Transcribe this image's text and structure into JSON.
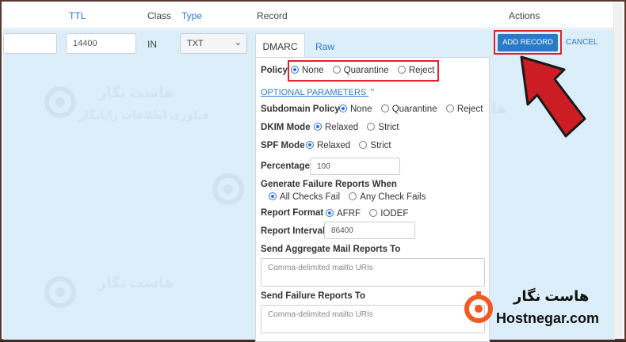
{
  "header": {
    "ttl": "TTL",
    "class": "Class",
    "type": "Type",
    "record": "Record",
    "actions": "Actions"
  },
  "row": {
    "ttl_value": "14400",
    "class_value": "IN",
    "type_value": "TXT"
  },
  "tabs": {
    "dmarc": "DMARC",
    "raw": "Raw"
  },
  "policy": {
    "label": "Policy",
    "options": [
      "None",
      "Quarantine",
      "Reject"
    ],
    "selected": "None"
  },
  "optional_parameters": "OPTIONAL PARAMETERS",
  "subdomain_policy": {
    "label": "Subdomain Policy",
    "options": [
      "None",
      "Quarantine",
      "Reject"
    ],
    "selected": "None"
  },
  "dkim_mode": {
    "label": "DKIM Mode",
    "options": [
      "Relaxed",
      "Strict"
    ],
    "selected": "Relaxed"
  },
  "spf_mode": {
    "label": "SPF Mode",
    "options": [
      "Relaxed",
      "Strict"
    ],
    "selected": "Relaxed"
  },
  "percentage": {
    "label": "Percentage",
    "value": "100"
  },
  "failure_reports": {
    "label": "Generate Failure Reports When",
    "options": [
      "All Checks Fail",
      "Any Check Fails"
    ],
    "selected": "All Checks Fail"
  },
  "report_format": {
    "label": "Report Format",
    "options": [
      "AFRF",
      "IODEF"
    ],
    "selected": "AFRF"
  },
  "report_interval": {
    "label": "Report Interval",
    "value": "86400"
  },
  "aggregate_reports": {
    "label": "Send Aggregate Mail Reports To",
    "placeholder": "Comma-delimited mailto URIs"
  },
  "failure_reports_to": {
    "label": "Send Failure Reports To",
    "placeholder": "Comma-delimited mailto URIs"
  },
  "actions": {
    "add_record": "ADD RECORD",
    "cancel": "CANCEL"
  },
  "brand": {
    "name_fa": "هاست نگار",
    "name_en": "Hostnegar.com"
  },
  "watermark": {
    "line1": "هاست نگار",
    "line2": "فناوری اطلاعات رایانگار"
  },
  "colors": {
    "accent": "#2a7bc5",
    "highlight": "#e0232b",
    "brand_orange": "#f15a22"
  }
}
